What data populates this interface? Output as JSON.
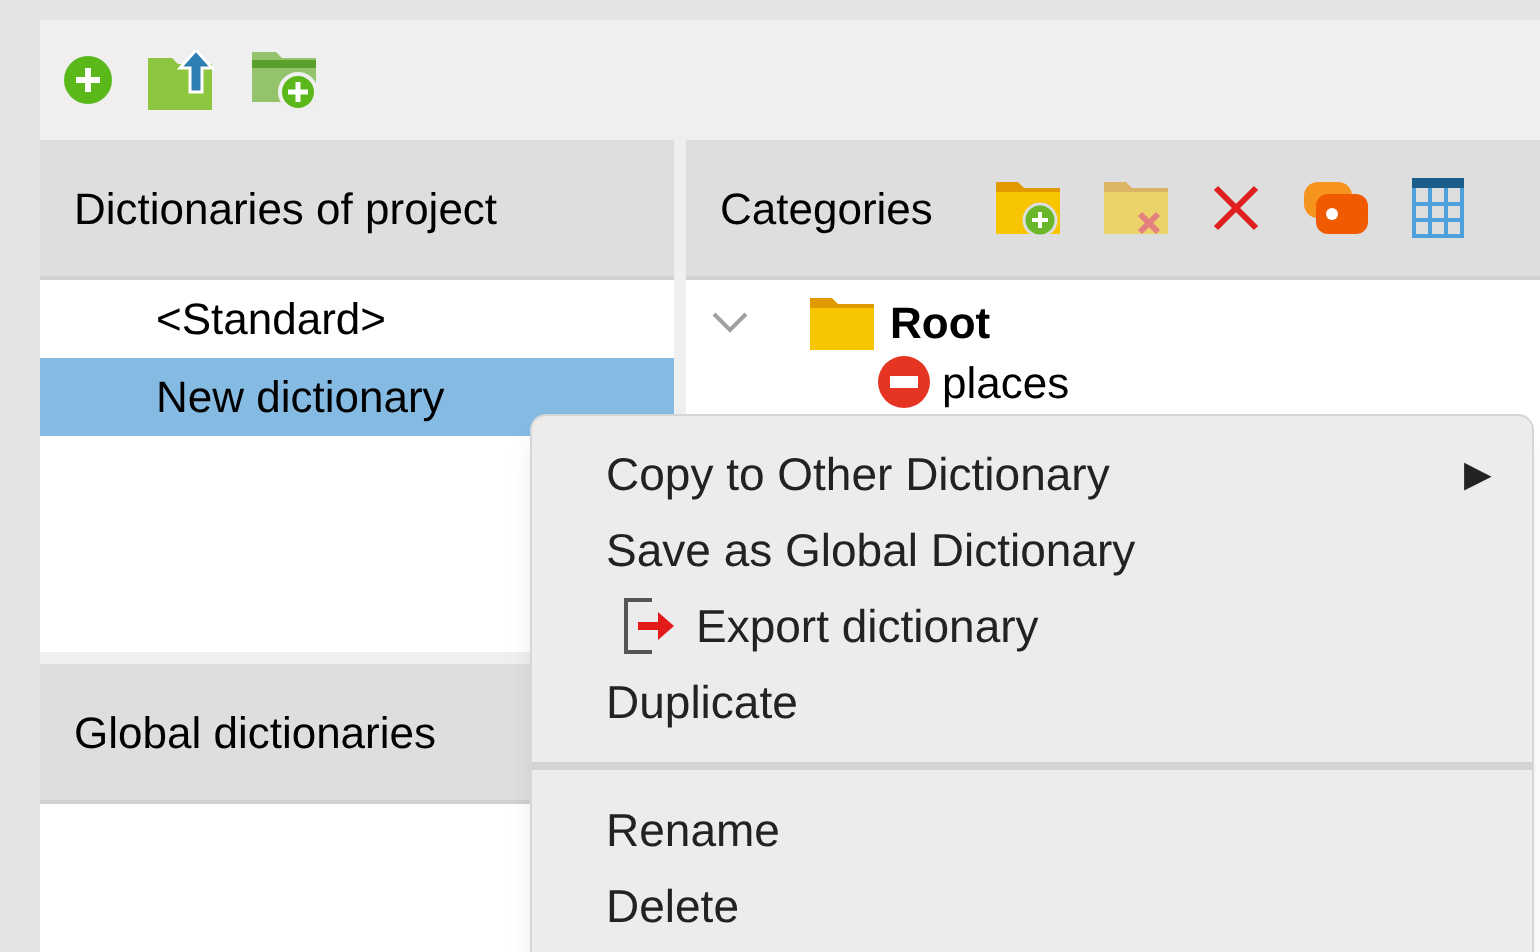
{
  "left_panel": {
    "title": "Dictionaries of project",
    "items": [
      {
        "label": "<Standard>",
        "selected": false
      },
      {
        "label": "New dictionary",
        "selected": true
      }
    ]
  },
  "global_panel": {
    "title": "Global dictionaries"
  },
  "categories_panel": {
    "title": "Categories",
    "tree": [
      {
        "label": "Root",
        "expanded": true,
        "children": [
          {
            "label": "places"
          }
        ]
      }
    ]
  },
  "context_menu": [
    {
      "kind": "submenu",
      "label": "Copy to Other Dictionary",
      "arrow": "▶"
    },
    {
      "kind": "plain",
      "label": "Save as Global Dictionary"
    },
    {
      "kind": "export",
      "label": "Export dictionary"
    },
    {
      "kind": "plain",
      "label": "Duplicate"
    },
    {
      "kind": "separator"
    },
    {
      "kind": "plain",
      "label": "Rename"
    },
    {
      "kind": "plain",
      "label": "Delete"
    }
  ]
}
